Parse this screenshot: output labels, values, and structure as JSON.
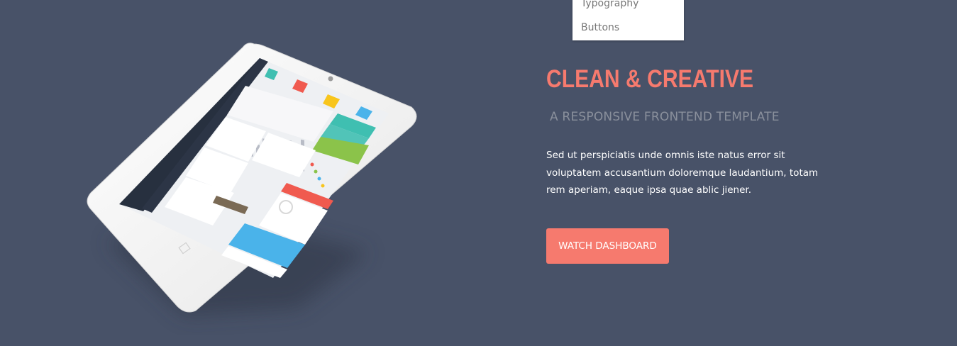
{
  "dropdown": {
    "items": [
      "Typography",
      "Buttons"
    ]
  },
  "hero": {
    "title": "CLEAN & CREATIVE",
    "subtitle": "A RESPONSIVE FRONTEND TEMPLATE",
    "description": "Sed ut perspiciatis unde omnis iste natus error sit voluptatem accusantium doloremque laudantium, totam rem aperiam, eaque ipsa quae ablic jiener.",
    "button_label": "WATCH DASHBOARD"
  },
  "colors": {
    "background": "#485268",
    "accent": "#f67a6e",
    "subtitle": "#8a909c",
    "text": "#ffffff"
  },
  "illustration": {
    "name": "tablet-dashboard-mockup"
  }
}
